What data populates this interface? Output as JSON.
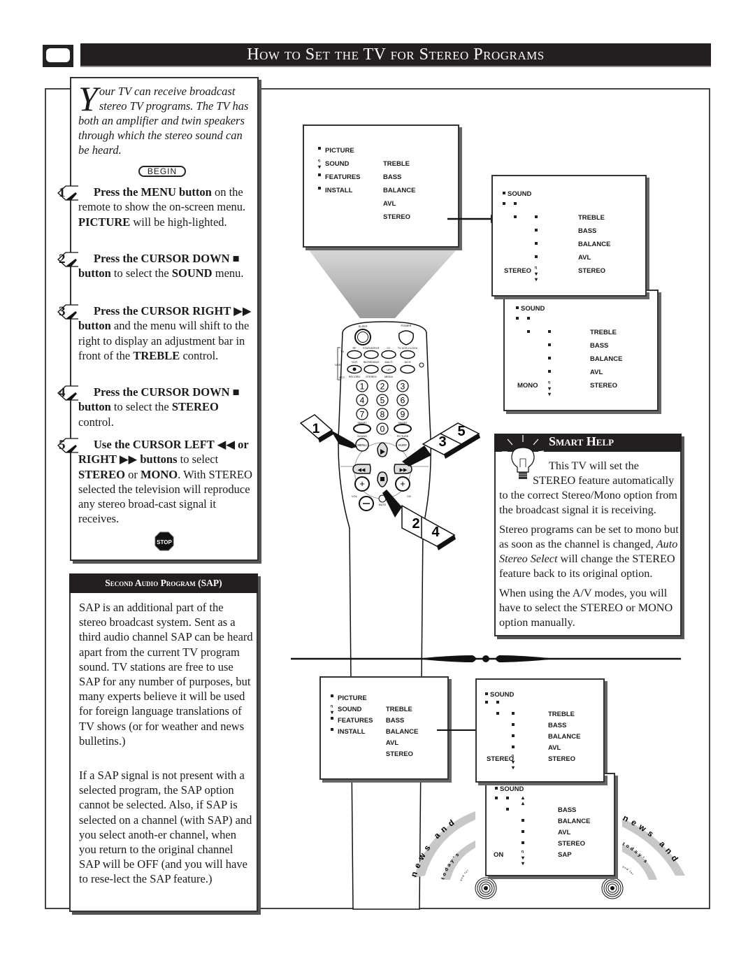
{
  "header": {
    "title": "How to Set the TV for Stereo Programs",
    "icon": "tv-icon"
  },
  "intro": {
    "dropcap": "Y",
    "text": "our TV can receive broadcast stereo TV programs.  The TV has both an amplifier and twin speakers through which the stereo sound can be heard."
  },
  "begin_label": "BEGIN",
  "steps": [
    {
      "num": "1",
      "parts": [
        {
          "b": "Press the MENU button"
        },
        {
          "t": " on the remote to show the on-screen menu. "
        },
        {
          "b": "PICTURE"
        },
        {
          "t": " will be high-lighted."
        }
      ]
    },
    {
      "num": "2",
      "parts": [
        {
          "b": "Press the CURSOR DOWN ■ button"
        },
        {
          "t": " to select the "
        },
        {
          "b": "SOUND"
        },
        {
          "t": " menu."
        }
      ]
    },
    {
      "num": "3",
      "parts": [
        {
          "b": "Press the CURSOR RIGHT ▶▶ button"
        },
        {
          "t": " and the menu will shift to the right to display an adjustment bar in front of the "
        },
        {
          "b": "TREBLE"
        },
        {
          "t": " control."
        }
      ]
    },
    {
      "num": "4",
      "parts": [
        {
          "b": "Press the CURSOR DOWN ■ button"
        },
        {
          "t": " to select the "
        },
        {
          "b": "STEREO"
        },
        {
          "t": " control."
        }
      ]
    },
    {
      "num": "5",
      "parts": [
        {
          "b": "Use the CURSOR LEFT ◀◀ or RIGHT ▶▶ buttons"
        },
        {
          "t": " to select "
        },
        {
          "b": "STEREO"
        },
        {
          "t": " or "
        },
        {
          "b": "MONO"
        },
        {
          "t": ". With STEREO selected the television will reproduce any stereo broad-cast signal it receives."
        }
      ]
    }
  ],
  "stop_label": "STOP",
  "sap": {
    "title": "Second Audio Program (SAP)",
    "para1": "SAP is an additional part of the stereo broadcast system. Sent as a third audio channel SAP can be heard apart from the current TV program sound. TV stations are free to use SAP for any number of purposes, but many experts believe it will be used for foreign language translations of TV shows (or for weather and news bulletins.)",
    "para2": " If a SAP signal is not present with a selected program, the SAP option cannot be selected. Also, if SAP is selected on a channel (with SAP) and you select anoth-er channel, when you return to the original channel SAP will be OFF (and you will have to rese-lect the SAP feature.)"
  },
  "menus": {
    "main": {
      "left": [
        "PICTURE",
        "SOUND",
        "FEATURES",
        "INSTALL"
      ],
      "right": [
        "TREBLE",
        "BASS",
        "BALANCE",
        "AVL",
        "STEREO"
      ]
    },
    "sound_stereo": {
      "title": "SOUND",
      "items": [
        "TREBLE",
        "BASS",
        "BALANCE",
        "AVL",
        "STEREO"
      ],
      "value": "STEREO"
    },
    "sound_mono": {
      "title": "SOUND",
      "items": [
        "TREBLE",
        "BASS",
        "BALANCE",
        "AVL",
        "STEREO"
      ],
      "value": "MONO"
    },
    "sound_sap": {
      "title": "SOUND",
      "items": [
        "BASS",
        "BALANCE",
        "AVL",
        "STEREO",
        "SAP"
      ],
      "value": "ON"
    }
  },
  "remote": {
    "labels": {
      "sleep": "SLEEP",
      "power": "POWER",
      "tv": "TV",
      "vcr": "VCR",
      "acc": "ACC",
      "rf": "RF",
      "status_exit": "STATUS/EXIT",
      "cc": "CC",
      "tv_vcr_clock": "TV-VCR-CLOCK",
      "vcr_btn": "VCR",
      "incredible": "INCREDIBLE",
      "multi": "MULTI",
      "ach": "A/CH",
      "record": "RECORD",
      "stereo": "STEREO",
      "media": "MEDIA",
      "smart_l": "SMART",
      "smart_r": "SMART",
      "sound": "SOUND",
      "picture": "PICTURE",
      "menu": "MENU",
      "surf": "SURF",
      "vol": "VOL",
      "ch": "CH",
      "mute": "MUTE",
      "up": "UP"
    },
    "digits": [
      "1",
      "2",
      "3",
      "4",
      "5",
      "6",
      "7",
      "8",
      "9",
      "0"
    ],
    "callouts": [
      "1",
      "3",
      "5",
      "2",
      "4"
    ]
  },
  "smart_help": {
    "title": "Smart Help",
    "para1_line1": "This TV will set the",
    "para1_line2": "STEREO feature automatically",
    "para1_rest": "to the correct Stereo/Mono option from the broadcast signal it is receiving.",
    "para2_a": "Stereo programs can be set to mono but as soon as the channel is changed, ",
    "para2_em": "Auto Stereo Select",
    "para2_b": " will change the STEREO feature back to its original option.",
    "para3": "When using the A/V modes, you will have to select the STEREO or MONO option manually."
  },
  "decor": {
    "arc_outer": "news and",
    "arc_middle": "today's",
    "arc_inner": "and for"
  }
}
